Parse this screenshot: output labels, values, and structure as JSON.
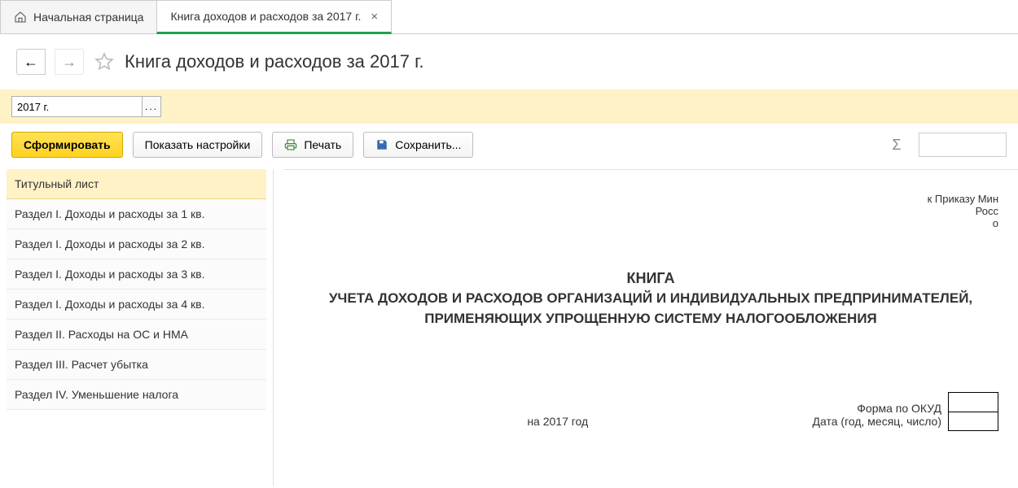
{
  "tabs": {
    "home_label": "Начальная страница",
    "active_label": "Книга доходов и расходов за 2017 г."
  },
  "header": {
    "title": "Книга доходов и расходов за 2017 г."
  },
  "params": {
    "period_value": "2017 г."
  },
  "toolbar": {
    "generate": "Сформировать",
    "show_settings": "Показать настройки",
    "print": "Печать",
    "save": "Сохранить...",
    "sigma": "Σ",
    "search_placeholder": ""
  },
  "sidebar": {
    "items": [
      "Титульный лист",
      "Раздел I. Доходы и расходы за 1 кв.",
      "Раздел I. Доходы и расходы за 2 кв.",
      "Раздел I. Доходы и расходы за 3 кв.",
      "Раздел I. Доходы и расходы за 4 кв.",
      "Раздел II. Расходы на ОС и НМА",
      "Раздел III. Расчет убытка",
      "Раздел IV. Уменьшение налога"
    ],
    "selected_index": 0
  },
  "document": {
    "annex_line1": "к Приказу Мин",
    "annex_line2": "Росс",
    "annex_line3": "о",
    "heading_1": "КНИГА",
    "heading_2": "УЧЕТА ДОХОДОВ И РАСХОДОВ ОРГАНИЗАЦИЙ И ИНДИВИДУАЛЬНЫХ ПРЕДПРИНИМАТЕЛЕЙ, ПРИМЕНЯЮЩИХ УПРОЩЕННУЮ СИСТЕМУ НАЛОГООБЛОЖЕНИЯ",
    "year_line": "на 2017 год",
    "form_okud": "Форма по ОКУД",
    "date_line": "Дата (год, месяц, число)"
  }
}
